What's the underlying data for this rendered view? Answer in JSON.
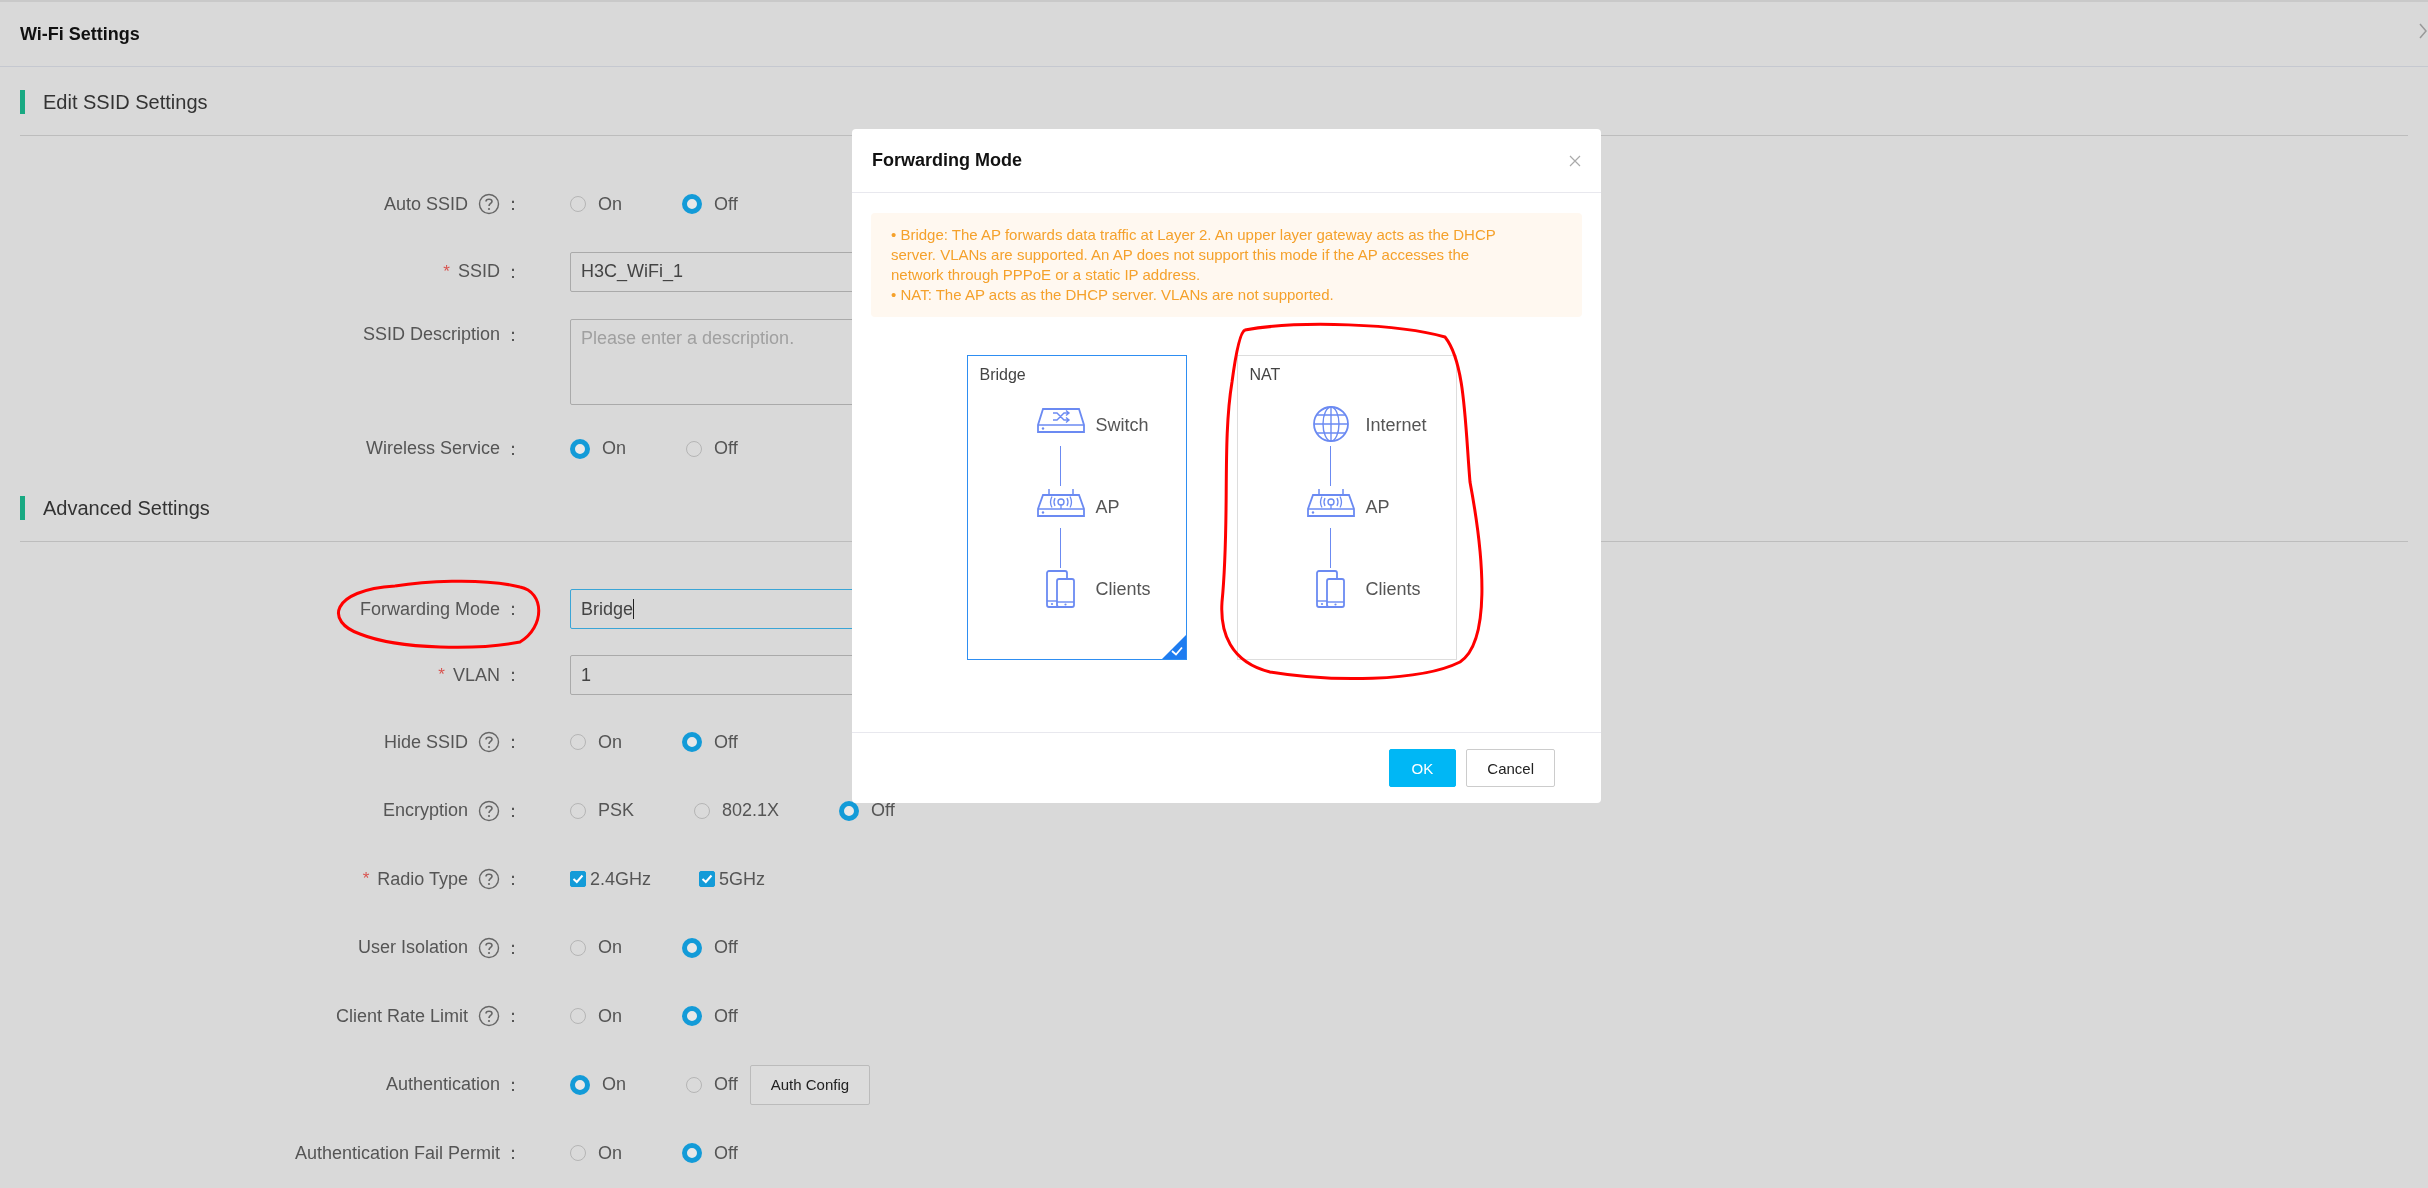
{
  "page": {
    "title": "Wi-Fi Settings"
  },
  "sections": [
    {
      "title": "Edit SSID Settings",
      "fields": [
        {
          "kind": "radio",
          "label": "Auto SSID",
          "help": true,
          "colon": "：",
          "options": [
            {
              "label": "On",
              "selected": false
            },
            {
              "label": "Off",
              "selected": true
            }
          ]
        },
        {
          "kind": "input",
          "label": "SSID",
          "required_mark": "*",
          "colon": "：",
          "value": "H3C_WiFi_1",
          "focused": false
        },
        {
          "kind": "textarea",
          "label": "SSID Description",
          "colon": "：",
          "placeholder": "Please enter a description."
        },
        {
          "kind": "radio",
          "label": "Wireless Service",
          "colon": "：",
          "options": [
            {
              "label": "On",
              "selected": true
            },
            {
              "label": "Off",
              "selected": false
            }
          ]
        }
      ]
    },
    {
      "title": "Advanced Settings",
      "fields": [
        {
          "kind": "input",
          "label": "Forwarding Mode",
          "colon": "：",
          "value": "Bridge",
          "focused": true
        },
        {
          "kind": "input",
          "label": "VLAN",
          "required_mark": "*",
          "colon": "：",
          "value": "1",
          "focused": false
        },
        {
          "kind": "radio",
          "label": "Hide SSID",
          "help": true,
          "colon": "：",
          "options": [
            {
              "label": "On",
              "selected": false
            },
            {
              "label": "Off",
              "selected": true
            }
          ]
        },
        {
          "kind": "radio",
          "label": "Encryption",
          "help": true,
          "colon": "：",
          "options": [
            {
              "label": "PSK",
              "selected": false
            },
            {
              "label": "802.1X",
              "selected": false
            },
            {
              "label": "Off",
              "selected": true
            }
          ]
        },
        {
          "kind": "checkbox",
          "label": "Radio Type",
          "required_mark": "*",
          "help": true,
          "colon": "：",
          "options": [
            {
              "label": "2.4GHz",
              "checked": true
            },
            {
              "label": "5GHz",
              "checked": true
            }
          ]
        },
        {
          "kind": "radio",
          "label": "User Isolation",
          "help": true,
          "colon": "：",
          "options": [
            {
              "label": "On",
              "selected": false
            },
            {
              "label": "Off",
              "selected": true
            }
          ]
        },
        {
          "kind": "radio",
          "label": "Client Rate Limit",
          "help": true,
          "colon": "：",
          "options": [
            {
              "label": "On",
              "selected": false
            },
            {
              "label": "Off",
              "selected": true
            }
          ]
        },
        {
          "kind": "radio",
          "label": "Authentication",
          "colon": "：",
          "options": [
            {
              "label": "On",
              "selected": true
            },
            {
              "label": "Off",
              "selected": false
            }
          ],
          "button": "Auth Config"
        },
        {
          "kind": "radio",
          "label": "Authentication Fail Permit",
          "colon": "：",
          "options": [
            {
              "label": "On",
              "selected": false
            },
            {
              "label": "Off",
              "selected": true
            }
          ]
        }
      ]
    }
  ],
  "modal": {
    "title": "Forwarding Mode",
    "notes": [
      "• Bridge: The AP forwards data traffic at Layer 2. An upper layer gateway acts as the DHCP server. VLANs are supported. An AP does not support this mode if the AP accesses the network through PPPoE or a static IP address.",
      "• NAT: The AP acts as the DHCP server. VLANs are not supported."
    ],
    "options": [
      {
        "title": "Bridge",
        "selected": true,
        "nodes": [
          {
            "kind": "switch",
            "label": "Switch"
          },
          {
            "kind": "ap",
            "label": "AP"
          },
          {
            "kind": "clients",
            "label": "Clients"
          }
        ]
      },
      {
        "title": "NAT",
        "selected": false,
        "nodes": [
          {
            "kind": "internet",
            "label": "Internet"
          },
          {
            "kind": "ap",
            "label": "AP"
          },
          {
            "kind": "clients",
            "label": "Clients"
          }
        ]
      }
    ],
    "buttons": [
      {
        "label": "OK",
        "kind": "primary"
      },
      {
        "label": "Cancel",
        "kind": "default"
      }
    ]
  }
}
